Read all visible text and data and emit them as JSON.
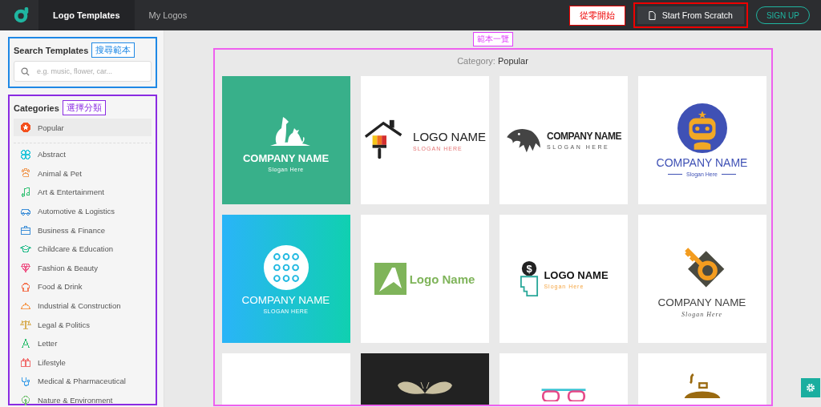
{
  "header": {
    "tabs": [
      {
        "label": "Logo Templates",
        "selected": true
      },
      {
        "label": "My Logos",
        "selected": false
      }
    ],
    "scratch_annotation": "從零開始",
    "scratch_button": "Start From Scratch",
    "signup_button": "SIGN UP"
  },
  "sidebar": {
    "search": {
      "title": "Search Templates",
      "annotation": "搜尋範本",
      "placeholder": "e.g. music, flower, car..."
    },
    "categories": {
      "title": "Categories",
      "annotation": "選擇分類",
      "items": [
        {
          "label": "Popular",
          "selected": true,
          "color": "#f4511e"
        },
        {
          "label": "Abstract",
          "selected": false,
          "color": "#26c6da"
        },
        {
          "label": "Animal & Pet",
          "selected": false,
          "color": "#f0a060"
        },
        {
          "label": "Art & Entertainment",
          "selected": false,
          "color": "#2fbf71"
        },
        {
          "label": "Automotive & Logistics",
          "selected": false,
          "color": "#3d8ed8"
        },
        {
          "label": "Business & Finance",
          "selected": false,
          "color": "#3d8ed8"
        },
        {
          "label": "Childcare & Education",
          "selected": false,
          "color": "#2fbf90"
        },
        {
          "label": "Fashion & Beauty",
          "selected": false,
          "color": "#ef5b8a"
        },
        {
          "label": "Food & Drink",
          "selected": false,
          "color": "#f47b5a"
        },
        {
          "label": "Industrial & Construction",
          "selected": false,
          "color": "#f5a05a"
        },
        {
          "label": "Legal & Politics",
          "selected": false,
          "color": "#d9b15a"
        },
        {
          "label": "Letter",
          "selected": false,
          "color": "#2fbf71"
        },
        {
          "label": "Lifestyle",
          "selected": false,
          "color": "#f06f6f"
        },
        {
          "label": "Medical & Pharmaceutical",
          "selected": false,
          "color": "#3d9ee8"
        },
        {
          "label": "Nature & Environment",
          "selected": false,
          "color": "#7cc47a"
        }
      ]
    }
  },
  "main": {
    "annotation": "範本一覽",
    "category_label": "Category:",
    "category_value": "Popular",
    "templates": [
      {
        "kind": "pets",
        "color": "#38b08a",
        "name": "COMPANY NAME",
        "slogan": "Slogan Here"
      },
      {
        "kind": "house",
        "color": "#ffffff",
        "name": "LOGO NAME",
        "slogan": "SLOGAN HERE"
      },
      {
        "kind": "eagle",
        "color": "#ffffff",
        "name": "COMPANY NAME",
        "slogan": "SLOGAN HERE"
      },
      {
        "kind": "robot",
        "color": "#ffffff",
        "name": "COMPANY NAME",
        "slogan": "Slogan Here"
      },
      {
        "kind": "dots",
        "color": "#2ab4f8",
        "name": "COMPANY NAME",
        "slogan": "SLOGAN HERE"
      },
      {
        "kind": "letter",
        "color": "#ffffff",
        "name": "Logo Name"
      },
      {
        "kind": "dollar",
        "color": "#ffffff",
        "symbol": "$",
        "name": "LOGO NAME",
        "slogan": "Slogan Here"
      },
      {
        "kind": "key",
        "color": "#ffffff",
        "name": "COMPANY NAME",
        "slogan": "Slogan Here"
      },
      {
        "kind": "blank",
        "color": "#ffffff"
      },
      {
        "kind": "moth",
        "color": "#222222"
      },
      {
        "kind": "glasses",
        "color": "#ffffff"
      },
      {
        "kind": "pot",
        "color": "#ffffff"
      }
    ]
  }
}
